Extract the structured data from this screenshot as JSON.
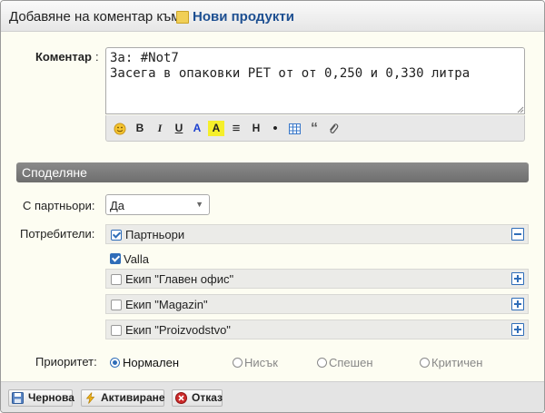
{
  "dialog": {
    "title_prefix": "Добавяне на коментар към",
    "title_link": "Нови продукти"
  },
  "comment": {
    "label": "Коментар",
    "colon": ":",
    "value": "За: #Not7\nЗасега в опаковки PET от от 0,250 и 0,330 литра"
  },
  "editor_toolbar": {
    "buttons": [
      {
        "name": "emoji-icon",
        "glyph": "☺"
      },
      {
        "name": "bold-button",
        "glyph": "B"
      },
      {
        "name": "italic-button",
        "glyph": "I"
      },
      {
        "name": "underline-button",
        "glyph": "U"
      },
      {
        "name": "text-color-button",
        "glyph": "A"
      },
      {
        "name": "highlight-button",
        "glyph": "A"
      },
      {
        "name": "align-icon",
        "glyph": "≡"
      },
      {
        "name": "heading-button",
        "glyph": "H"
      },
      {
        "name": "bullet-button",
        "glyph": "•"
      },
      {
        "name": "table-icon",
        "glyph": "▦"
      },
      {
        "name": "quote-icon",
        "glyph": "“"
      },
      {
        "name": "attach-icon",
        "glyph": "⌀"
      }
    ]
  },
  "sharing": {
    "section_title": "Споделяне",
    "partners_label": "С партньори:",
    "partners_value": "Да",
    "users_label": "Потребители:",
    "groups": [
      {
        "label": "Партньори",
        "checked": true,
        "expanded": true
      },
      {
        "label": "Valla",
        "checked": true,
        "child": true
      },
      {
        "label": "Екип \"Главен офис\"",
        "checked": false,
        "expanded": false
      },
      {
        "label": "Екип \"Magazin\"",
        "checked": false,
        "expanded": false
      },
      {
        "label": "Екип \"Proizvodstvo\"",
        "checked": false,
        "expanded": false
      }
    ]
  },
  "priority": {
    "label": "Приоритет:",
    "options": [
      "Нормален",
      "Нисък",
      "Спешен",
      "Критичен"
    ],
    "selected": "Нормален"
  },
  "footer": {
    "draft": "Чернова",
    "activate": "Активиране",
    "cancel": "Отказ"
  },
  "colors": {
    "link": "#1d4f91",
    "section": "#7a7a7a",
    "accent": "#2f6db8"
  }
}
